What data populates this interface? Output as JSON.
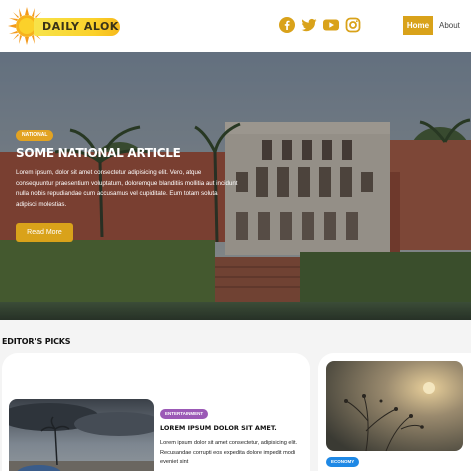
{
  "header": {
    "logo_text": "DAILY ALOK",
    "social_icons": [
      "facebook-icon",
      "twitter-icon",
      "youtube-icon",
      "instagram-icon"
    ],
    "nav": {
      "home": "Home",
      "about": "About"
    },
    "accent_color": "#d9a21a"
  },
  "hero": {
    "badge": "NATIONAL",
    "title": "SOME NATIONAL ARTICLE",
    "text": "Lorem ipsum, dolor sit amet consectetur adipisicing elit. Vero, atque consequuntur praesentium voluptatum, doloremque blanditiis mollitia aut incidunt nulla nobis repudiandae cum accusamus vel cupiditate. Eum totam soluta adipisci molestias.",
    "button": "Read More"
  },
  "editors_picks": {
    "title": "EDITOR'S PICKS",
    "cards": [
      {
        "badge": "ENTERTAINMENT",
        "badge_color": "#9b59b6",
        "title": "LOREM IPSUM DOLOR SIT AMET.",
        "text": "Lorem ipsum dolor sit amet consectetur, adipisicing elit. Recusandae corrupti eos expedita dolore impedit modi eveniet sint"
      },
      {
        "badge": "ECONOMY",
        "badge_color": "#1e88e5"
      }
    ]
  }
}
